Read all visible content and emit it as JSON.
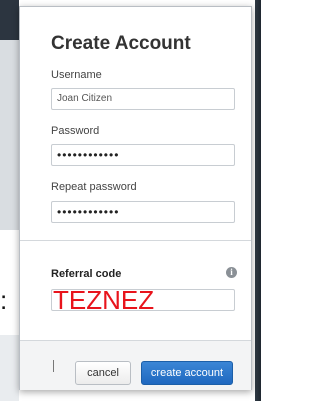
{
  "modal": {
    "title": "Create Account",
    "username": {
      "label": "Username",
      "value": "Joan Citizen"
    },
    "password": {
      "label": "Password",
      "value": "••••••••••••"
    },
    "repeat_password": {
      "label": "Repeat password",
      "value": "••••••••••••"
    },
    "referral": {
      "label": "Referral code",
      "value": "TEZNEZ",
      "info_icon": "info-icon"
    },
    "footer": {
      "cancel_label": "cancel",
      "create_label": "create account"
    }
  },
  "overlay": {
    "colon": ":"
  },
  "colors": {
    "primary_button": "#1f68c0",
    "referral_annotation": "#e8141c"
  }
}
